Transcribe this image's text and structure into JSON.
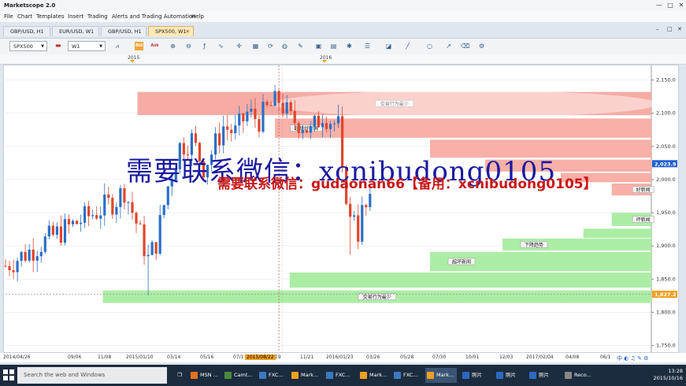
{
  "window": {
    "title": "Marketscope 2.0",
    "minimize": "—",
    "maximize": "□",
    "close": "✕"
  },
  "menu": [
    "File",
    "Chart",
    "Templates",
    "Insert",
    "Trading",
    "Alerts and Trading Automation",
    "Help"
  ],
  "tabs": [
    {
      "label": "GBP/USD, H1",
      "active": false
    },
    {
      "label": "EUR/USD, W1",
      "active": false
    },
    {
      "label": "GBP/USD, H1",
      "active": false
    },
    {
      "label": "SPX500, W1",
      "active": true,
      "close": "✕"
    }
  ],
  "tabbar_right": {
    "min": "–",
    "max": "□",
    "close": "✕"
  },
  "toolbar": {
    "instrument": "SPX500",
    "timeframe": "W1",
    "bid_label": "Bid",
    "ask_label": "Ask"
  },
  "timeline": {
    "years": [
      "2015",
      "2016"
    ]
  },
  "chart_data": {
    "type": "candlestick",
    "y_ticks": [
      "2,150.0",
      "2,100.0",
      "2,050.0",
      "2,000.0",
      "1,950.0",
      "1,900.0",
      "1,850.0",
      "1,800.0",
      "1,750.0"
    ],
    "ylim": [
      1740,
      2172
    ],
    "x_ticks": [
      "2014/04/26",
      "09/06",
      "11/08",
      "2015/01/10",
      "03/14",
      "05/16",
      "07/1",
      "2015/08/22",
      "19",
      "11/21",
      "2016/01/23",
      "03/26",
      "05/28",
      "07/30",
      "10/01",
      "12/03",
      "2017/02/04",
      "04/08",
      "06/1"
    ],
    "highlight_x": "2015/08/22",
    "price_labels": [
      {
        "value": "2,023.9",
        "price": 2023.9,
        "color": "#1f5fd0"
      },
      {
        "value": "1,827.2",
        "price": 1827.2,
        "color": "#f0a020"
      }
    ],
    "zones": [
      {
        "label": "交易行为最少",
        "color": "#f5a8a0",
        "from": "2014/12/15",
        "top": 2132,
        "bottom": 2097
      },
      {
        "label": "超级好新闻",
        "color": "#f8aca2",
        "from": "2015/08/15",
        "top": 2092,
        "bottom": 2063
      },
      {
        "label": "",
        "color": "#f8aca2",
        "from": "2016/05/15",
        "top": 2060,
        "bottom": 2033
      },
      {
        "label": "",
        "color": "#f8aca2",
        "from": "2016/08/20",
        "top": 2030,
        "bottom": 2012
      },
      {
        "label": "",
        "color": "#f8aca2",
        "from": "2017/01/01",
        "top": 2010,
        "bottom": 1996
      },
      {
        "label": "好新闻",
        "color": "#f8aca2",
        "from": "2017/04/01",
        "top": 1994,
        "bottom": 1976
      },
      {
        "label": "坏新闻",
        "color": "#a8eca0",
        "from": "2017/04/01",
        "top": 1950,
        "bottom": 1930
      },
      {
        "label": "",
        "color": "#a8eca0",
        "from": "2017/02/10",
        "top": 1926,
        "bottom": 1912
      },
      {
        "label": "下降趋势",
        "color": "#a8eca0",
        "from": "2016/09/20",
        "top": 1911,
        "bottom": 1893
      },
      {
        "label": "超坏新闻",
        "color": "#a8eca0",
        "from": "2016/05/15",
        "top": 1891,
        "bottom": 1862
      },
      {
        "label": "",
        "color": "#a8eca0",
        "from": "2015/09/10",
        "top": 1860,
        "bottom": 1837
      },
      {
        "label": "交易行为最少",
        "color": "#a8eca0",
        "from": "2014/10/15",
        "top": 1833,
        "bottom": 1814
      }
    ],
    "candles": {
      "start": "2014/04/26",
      "interval": "week",
      "last": "2015/10/10",
      "trend_points": [
        [
          0,
          1870
        ],
        [
          6,
          1892
        ],
        [
          12,
          1915
        ],
        [
          18,
          1935
        ],
        [
          24,
          1955
        ],
        [
          28,
          1970
        ],
        [
          30,
          1985
        ],
        [
          33,
          1935
        ],
        [
          36,
          1880
        ],
        [
          38,
          1905
        ],
        [
          41,
          1990
        ],
        [
          44,
          2050
        ],
        [
          47,
          2060
        ],
        [
          50,
          2020
        ],
        [
          52,
          2040
        ],
        [
          55,
          2080
        ],
        [
          58,
          2070
        ],
        [
          61,
          2100
        ],
        [
          64,
          2090
        ],
        [
          66,
          2105
        ],
        [
          69,
          2120
        ],
        [
          72,
          2090
        ],
        [
          75,
          2085
        ],
        [
          77,
          2070
        ],
        [
          80,
          2100
        ],
        [
          84,
          2080
        ],
        [
          85,
          2000
        ],
        [
          86,
          1980
        ],
        [
          87,
          1935
        ],
        [
          88,
          1955
        ],
        [
          89,
          1920
        ],
        [
          90,
          1950
        ],
        [
          92,
          1960
        ]
      ]
    }
  },
  "watermarks": {
    "main": "需要联系微信：xcnibudong0105",
    "sub": "需要联系微信：gudaonan66【备用：xcnibudong0105】"
  },
  "taskbar": {
    "search_placeholder": "Search the web and Windows",
    "apps": [
      {
        "label": "MSN ...",
        "color": "#e8731a"
      },
      {
        "label": "Camt...",
        "color": "#4a8a3a"
      },
      {
        "label": "FXC...",
        "color": "#3a7ac0"
      },
      {
        "label": "Mark...",
        "color": "#f0a020"
      },
      {
        "label": "FXC...",
        "color": "#3a7ac0"
      },
      {
        "label": "Mark...",
        "color": "#f0a020"
      },
      {
        "label": "FXC...",
        "color": "#3a7ac0"
      },
      {
        "label": "Mark...",
        "color": "#f0a020",
        "active": true
      },
      {
        "label": "照片",
        "color": "#2a6ac0"
      },
      {
        "label": "照片",
        "color": "#2a6ac0"
      },
      {
        "label": "照片",
        "color": "#2a6ac0"
      },
      {
        "label": "Reco...",
        "color": "#888888"
      }
    ],
    "time": "13:28",
    "date": "2015/10/16",
    "tray": "中 ◐ ♫ ✎ ⚙"
  }
}
